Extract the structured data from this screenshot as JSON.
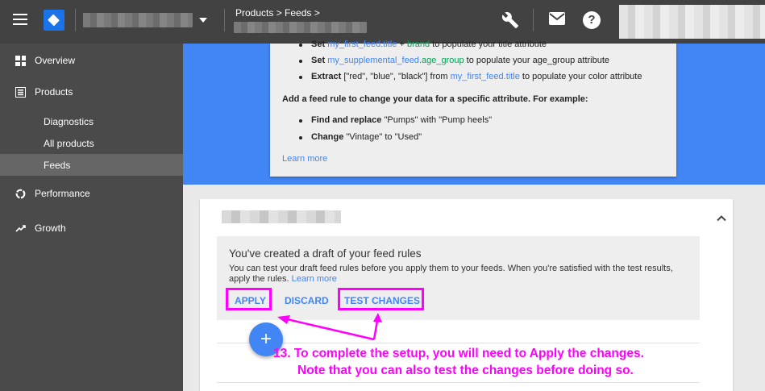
{
  "header": {
    "breadcrumb": "Products > Feeds >",
    "icons": [
      "menu-icon",
      "merchant-center-logo",
      "wrench-icon",
      "mail-icon",
      "help-icon"
    ],
    "help_glyph": "?"
  },
  "sidebar": {
    "items": [
      {
        "label": "Overview",
        "icon": "dashboard-icon"
      },
      {
        "label": "Products",
        "icon": "list-icon"
      },
      {
        "label": "Diagnostics"
      },
      {
        "label": "All products"
      },
      {
        "label": "Feeds",
        "active": true
      },
      {
        "label": "Performance",
        "icon": "donut-icon"
      },
      {
        "label": "Growth",
        "icon": "trending-up-icon"
      }
    ]
  },
  "info_card": {
    "bullets_top": [
      {
        "verb": "Set",
        "feed": "my_first_feed",
        "sep1": ".",
        "attr": "title",
        "mid": " + ",
        "attr2": "brand",
        "rest": " to populate your title attribute"
      },
      {
        "verb": "Set",
        "feed": "my_supplemental_feed",
        "sep1": ".",
        "attr": "age_group",
        "rest": " to populate your age_group attribute"
      },
      {
        "verb": "Extract",
        "pre": " [\"red\", \"blue\", \"black\"] from ",
        "feed": "my_first_feed",
        "sep1": ".",
        "attr": "title",
        "rest": " to populate your color attribute"
      }
    ],
    "heading": "Add a feed rule to change your data for a specific attribute. For example:",
    "bullets_bottom": [
      {
        "verb": "Find and replace",
        "rest": " \"Pumps\" with \"Pump heels\""
      },
      {
        "verb": "Change",
        "rest": " \"Vintage\" to \"Used\""
      }
    ],
    "learn_more": "Learn more"
  },
  "draft_panel": {
    "title": "You've created a draft of your feed rules",
    "body": "You can test your draft feed rules before you apply them to your feeds. When you're satisfied with the test results, apply the rules.",
    "learn_more": "Learn more",
    "buttons": {
      "apply": "APPLY",
      "discard": "DISCARD",
      "test": "TEST CHANGES"
    }
  },
  "fab": {
    "label": "+"
  },
  "annotation": {
    "line1": "13. To complete the setup, you will need to Apply the changes.",
    "line2": "Note that you can also test the changes before doing so.",
    "color": "#ff00ff"
  },
  "colors": {
    "topbar": "#424242",
    "sidebar": "#4a4a4a",
    "accent": "#4285f4",
    "highlight": "#ff00ff"
  }
}
